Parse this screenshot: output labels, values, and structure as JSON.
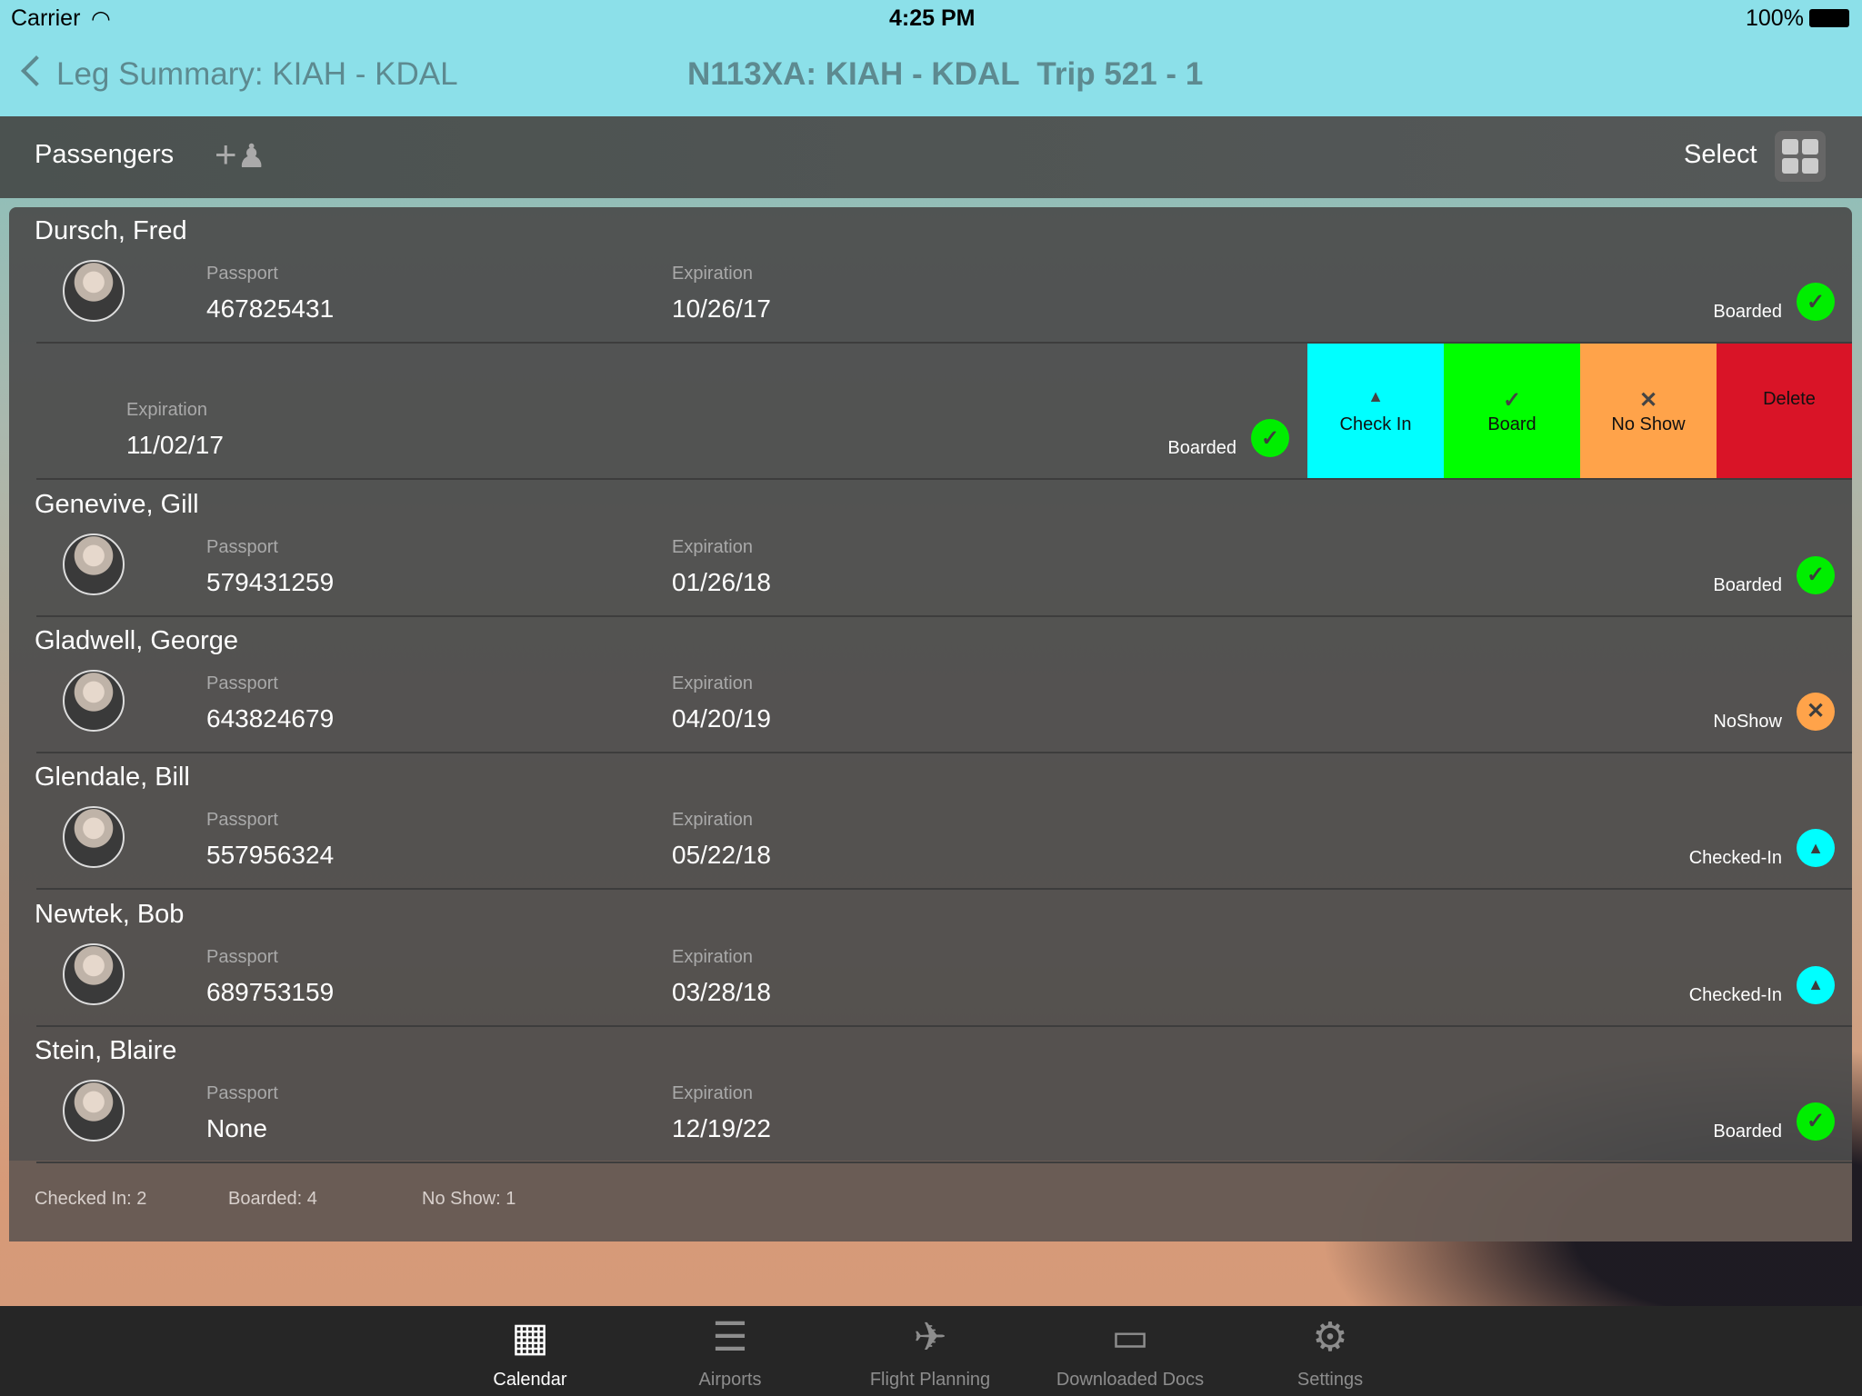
{
  "status_bar": {
    "carrier": "Carrier",
    "time": "4:25 PM",
    "battery": "100%"
  },
  "nav": {
    "back_label": "Leg Summary: KIAH - KDAL",
    "title": "N113XA: KIAH - KDAL  Trip 521 - 1"
  },
  "header": {
    "title": "Passengers",
    "select_label": "Select"
  },
  "colors": {
    "boarded": "#00ee00",
    "noshow": "#ffa34a",
    "checkedin": "#00ffff",
    "delete": "#d91427"
  },
  "passengers": [
    {
      "name": "Dursch, Fred",
      "passport_label": "Passport",
      "passport": "467825431",
      "expiration_label": "Expiration",
      "expiration": "10/26/17",
      "status": "Boarded",
      "status_icon": "check-icon"
    },
    {
      "swiped": true,
      "expiration_label": "Expiration",
      "expiration": "11/02/17",
      "status": "Boarded",
      "status_icon": "check-icon"
    },
    {
      "name": "Genevive, Gill",
      "passport_label": "Passport",
      "passport": "579431259",
      "expiration_label": "Expiration",
      "expiration": "01/26/18",
      "status": "Boarded",
      "status_icon": "check-icon"
    },
    {
      "name": "Gladwell, George",
      "passport_label": "Passport",
      "passport": "643824679",
      "expiration_label": "Expiration",
      "expiration": "04/20/19",
      "status": "NoShow",
      "status_icon": "x-icon"
    },
    {
      "name": "Glendale, Bill",
      "passport_label": "Passport",
      "passport": "557956324",
      "expiration_label": "Expiration",
      "expiration": "05/22/18",
      "status": "Checked-In",
      "status_icon": "bell-icon"
    },
    {
      "name": "Newtek, Bob",
      "passport_label": "Passport",
      "passport": "689753159",
      "expiration_label": "Expiration",
      "expiration": "03/28/18",
      "status": "Checked-In",
      "status_icon": "bell-icon"
    },
    {
      "name": "Stein, Blaire",
      "passport_label": "Passport",
      "passport": "None",
      "expiration_label": "Expiration",
      "expiration": "12/19/22",
      "status": "Boarded",
      "status_icon": "check-icon"
    }
  ],
  "swipe_actions": [
    {
      "label": "Check In",
      "icon": "bell-icon",
      "color": "#00ffff"
    },
    {
      "label": "Board",
      "icon": "check-icon",
      "color": "#00ff00"
    },
    {
      "label": "No Show",
      "icon": "x-icon",
      "color": "#ffa34a"
    },
    {
      "label": "Delete",
      "icon": "",
      "color": "#d91427"
    }
  ],
  "footer": {
    "checked_in": "Checked In: 2",
    "boarded": "Boarded: 4",
    "no_show": "No Show: 1"
  },
  "tabs": [
    {
      "label": "Calendar",
      "icon": "calendar-icon",
      "active": true
    },
    {
      "label": "Airports",
      "icon": "list-icon"
    },
    {
      "label": "Flight Planning",
      "icon": "airplane-icon"
    },
    {
      "label": "Downloaded Docs",
      "icon": "folder-icon"
    },
    {
      "label": "Settings",
      "icon": "gear-icon"
    }
  ]
}
